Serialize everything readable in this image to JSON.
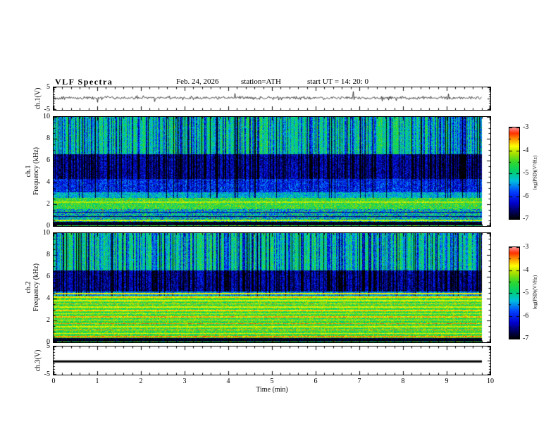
{
  "header": {
    "title": "VLF Spectra",
    "date": "Feb. 24, 2026",
    "station": "station=ATH",
    "start_ut": "start UT =  14: 20: 0"
  },
  "axes": {
    "x": {
      "label": "Time (min)",
      "min": 0,
      "max": 10,
      "tick_labels": [
        "0",
        "1",
        "2",
        "3",
        "4",
        "5",
        "6",
        "7",
        "8",
        "9",
        "10"
      ]
    },
    "wave1_y": {
      "label": "ch.1(V)",
      "min": -5,
      "max": 5,
      "tick_labels": [
        "5",
        "-5"
      ]
    },
    "spec1_y": {
      "label_line1": "ch.1",
      "label_line2": "Frequency (kHz)",
      "min": 0,
      "max": 10,
      "tick_labels": [
        "10",
        "8",
        "6",
        "4",
        "2",
        "0"
      ]
    },
    "spec2_y": {
      "label_line1": "ch.2",
      "label_line2": "Frequency (kHz)",
      "min": 0,
      "max": 10,
      "tick_labels": [
        "10",
        "8",
        "6",
        "4",
        "2",
        "0"
      ]
    },
    "wave3_y": {
      "label": "ch.3(V)",
      "min": -5,
      "max": 5,
      "tick_labels": [
        "5",
        "-5"
      ]
    }
  },
  "colorbar": {
    "label": "log(PSD)(V²/Hz)",
    "min": -7,
    "max": -3,
    "tick_labels": [
      "-3",
      "-4",
      "-5",
      "-6",
      "-7"
    ],
    "stops": [
      [
        0.0,
        "#000000"
      ],
      [
        0.07,
        "#00004a"
      ],
      [
        0.18,
        "#0000d0"
      ],
      [
        0.3,
        "#0040ff"
      ],
      [
        0.42,
        "#00c0e0"
      ],
      [
        0.52,
        "#00d070"
      ],
      [
        0.62,
        "#30d830"
      ],
      [
        0.72,
        "#a8e000"
      ],
      [
        0.8,
        "#ffff00"
      ],
      [
        0.88,
        "#ff9000"
      ],
      [
        0.94,
        "#ff3000"
      ],
      [
        1.0,
        "#ff9090"
      ]
    ]
  },
  "chart_data": [
    {
      "type": "line",
      "name": "ch1-waveform",
      "ylabel": "ch.1(V)",
      "xlim": [
        0,
        10
      ],
      "ylim": [
        -5,
        5
      ],
      "time_end_min": 9.8,
      "baseline": 0.3,
      "noise_amp": 0.7,
      "spike_rate": 0.025,
      "spike_amp": 5,
      "description": "Broadband noisy voltage trace near 0 V with intermittent impulsive spikes to about ±3 V"
    },
    {
      "type": "heatmap",
      "name": "ch1-spectrogram",
      "ylabel": "ch.1 Frequency (kHz)",
      "xlim": [
        0,
        10
      ],
      "ylim": [
        0,
        10
      ],
      "zlabel": "log(PSD)(V²/Hz)",
      "zlim": [
        -7,
        -3
      ],
      "time_end_min": 9.8,
      "bands": [
        {
          "f0": 6.6,
          "f1": 10.01,
          "level": -4.9,
          "noise": 0.45
        },
        {
          "f0": 4.35,
          "f1": 6.6,
          "level": -6.3,
          "noise": 0.5
        },
        {
          "f0": 3.1,
          "f1": 4.35,
          "level": -5.9,
          "noise": 0.55
        },
        {
          "f0": 2.6,
          "f1": 3.1,
          "level": -5.3,
          "noise": 0.5
        },
        {
          "f0": 1.6,
          "f1": 2.6,
          "level": -4.6,
          "noise": 0.55
        },
        {
          "f0": 0.45,
          "f1": 1.6,
          "level": -5.2,
          "noise": 0.9
        },
        {
          "f0": 0.1,
          "f1": 0.45,
          "level": -6.9,
          "noise": 0.3
        },
        {
          "f0": 0.0,
          "f1": 0.1,
          "level": -4.6,
          "noise": 0.5
        }
      ],
      "spectral_lines": [
        {
          "f": 0.55,
          "w": 0.05,
          "level": -4.0
        },
        {
          "f": 0.9,
          "w": 0.05,
          "level": -6.6
        },
        {
          "f": 1.3,
          "w": 0.05,
          "level": -6.4
        },
        {
          "f": 2.25,
          "w": 0.06,
          "level": -4.1
        }
      ],
      "sferic_rate": 0.45,
      "strong_sferic_rate": 0.06,
      "streak_fmin": 4.35,
      "strong_fmin": 2.6,
      "mid_fmin": 3.1,
      "red_speckle": 0.012,
      "description": "Green background PSD near -5 above 6.6 kHz crossed by dense dark-blue vertical sferic streaks; low-power dark-blue band 4.3-6.6 kHz; bright speckled band 1.6-2.6 kHz; black band below 0.45 kHz"
    },
    {
      "type": "heatmap",
      "name": "ch2-spectrogram",
      "ylabel": "ch.2 Frequency (kHz)",
      "xlim": [
        0,
        10
      ],
      "ylim": [
        0,
        10
      ],
      "zlabel": "log(PSD)(V²/Hz)",
      "zlim": [
        -7,
        -3
      ],
      "time_end_min": 9.8,
      "bands": [
        {
          "f0": 6.6,
          "f1": 10.01,
          "level": -4.9,
          "noise": 0.45
        },
        {
          "f0": 4.7,
          "f1": 6.6,
          "level": -6.3,
          "noise": 0.5
        },
        {
          "f0": 4.3,
          "f1": 4.7,
          "level": -5.5,
          "noise": 0.5
        },
        {
          "f0": 0.45,
          "f1": 4.3,
          "level": -4.55,
          "noise": 0.5
        },
        {
          "f0": 0.1,
          "f1": 0.45,
          "level": -6.9,
          "noise": 0.3
        },
        {
          "f0": 0.0,
          "f1": 0.1,
          "level": -4.6,
          "noise": 0.5
        }
      ],
      "spectral_lines": [
        {
          "f": 0.55,
          "w": 0.05,
          "level": -3.5
        },
        {
          "f": 0.85,
          "w": 0.05,
          "level": -3.8
        },
        {
          "f": 1.15,
          "w": 0.05,
          "level": -3.6
        },
        {
          "f": 1.45,
          "w": 0.05,
          "level": -3.9
        },
        {
          "f": 1.75,
          "w": 0.05,
          "level": -3.5
        },
        {
          "f": 2.05,
          "w": 0.05,
          "level": -3.85
        },
        {
          "f": 2.35,
          "w": 0.05,
          "level": -3.6
        },
        {
          "f": 2.65,
          "w": 0.05,
          "level": -3.9
        },
        {
          "f": 2.95,
          "w": 0.05,
          "level": -3.7
        },
        {
          "f": 3.25,
          "w": 0.05,
          "level": -3.9
        },
        {
          "f": 3.55,
          "w": 0.05,
          "level": -3.65
        },
        {
          "f": 3.85,
          "w": 0.05,
          "level": -3.9
        },
        {
          "f": 4.15,
          "w": 0.05,
          "level": -3.7
        },
        {
          "f": 4.5,
          "w": 0.05,
          "level": -3.8
        }
      ],
      "sferic_rate": 0.45,
      "strong_sferic_rate": 0.06,
      "streak_fmin": 4.7,
      "strong_fmin": 4.3,
      "mid_fmin": 99,
      "red_speckle": 0,
      "description": "Same sferic-streaked green/dark-blue structure above 4.3 kHz; below 4.3 kHz bright green region with many yellow-orange horizontal power-line harmonics; black band below 0.45 kHz"
    },
    {
      "type": "line",
      "name": "ch3-waveform",
      "ylabel": "ch.3(V)",
      "xlim": [
        0,
        10
      ],
      "ylim": [
        -5,
        5
      ],
      "time_end_min": 9.8,
      "constant_value": -0.3,
      "description": "Flat thick trace (inactive channel) at about -0.3 V"
    }
  ]
}
